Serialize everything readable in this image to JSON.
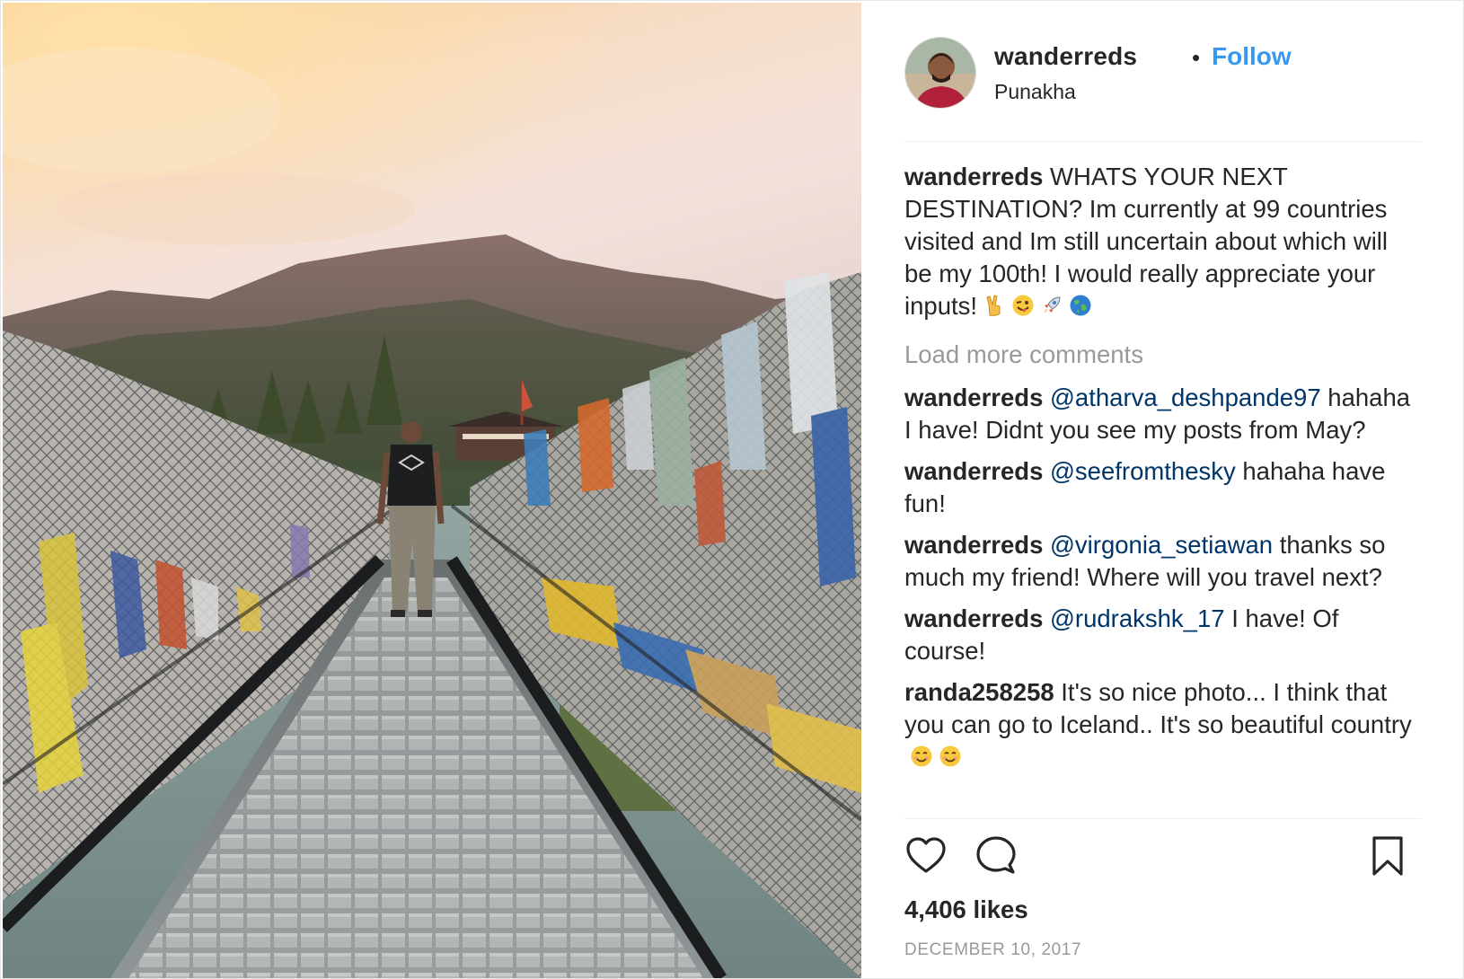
{
  "post": {
    "username": "wanderreds",
    "separator": "•",
    "follow_label": "Follow",
    "location": "Punakha",
    "caption": {
      "user": "wanderreds",
      "text": "WHATS YOUR NEXT DESTINATION? Im currently at 99 countries visited and Im still uncertain about which will be my 100th! I would really appreciate your inputs!",
      "emoji": [
        "victory-hand",
        "winking-face-tongue",
        "rocket",
        "globe"
      ]
    },
    "load_more_label": "Load more comments",
    "comments": [
      {
        "user": "wanderreds",
        "mention": "@atharva_deshpande97",
        "text": "hahaha I have! Didnt you see my posts from May?"
      },
      {
        "user": "wanderreds",
        "mention": "@seefromthesky",
        "text": "hahaha have fun!"
      },
      {
        "user": "wanderreds",
        "mention": "@virgonia_setiawan",
        "text": "thanks so much my friend! Where will you travel next?"
      },
      {
        "user": "wanderreds",
        "mention": "@rudrakshk_17",
        "text": "I have! Of course!"
      },
      {
        "user": "randa258258",
        "mention": "",
        "text": "It's so nice photo... I think that you can go to Iceland.. It's so beautiful country"
      }
    ],
    "likes": "4,406 likes",
    "date": "DECEMBER 10, 2017"
  },
  "icons": {
    "like": "heart-icon",
    "comment": "comment-icon",
    "save": "bookmark-icon"
  },
  "colors": {
    "link_blue": "#3897f0",
    "mention_blue": "#003569",
    "muted_gray": "#999999",
    "text": "#262626"
  }
}
